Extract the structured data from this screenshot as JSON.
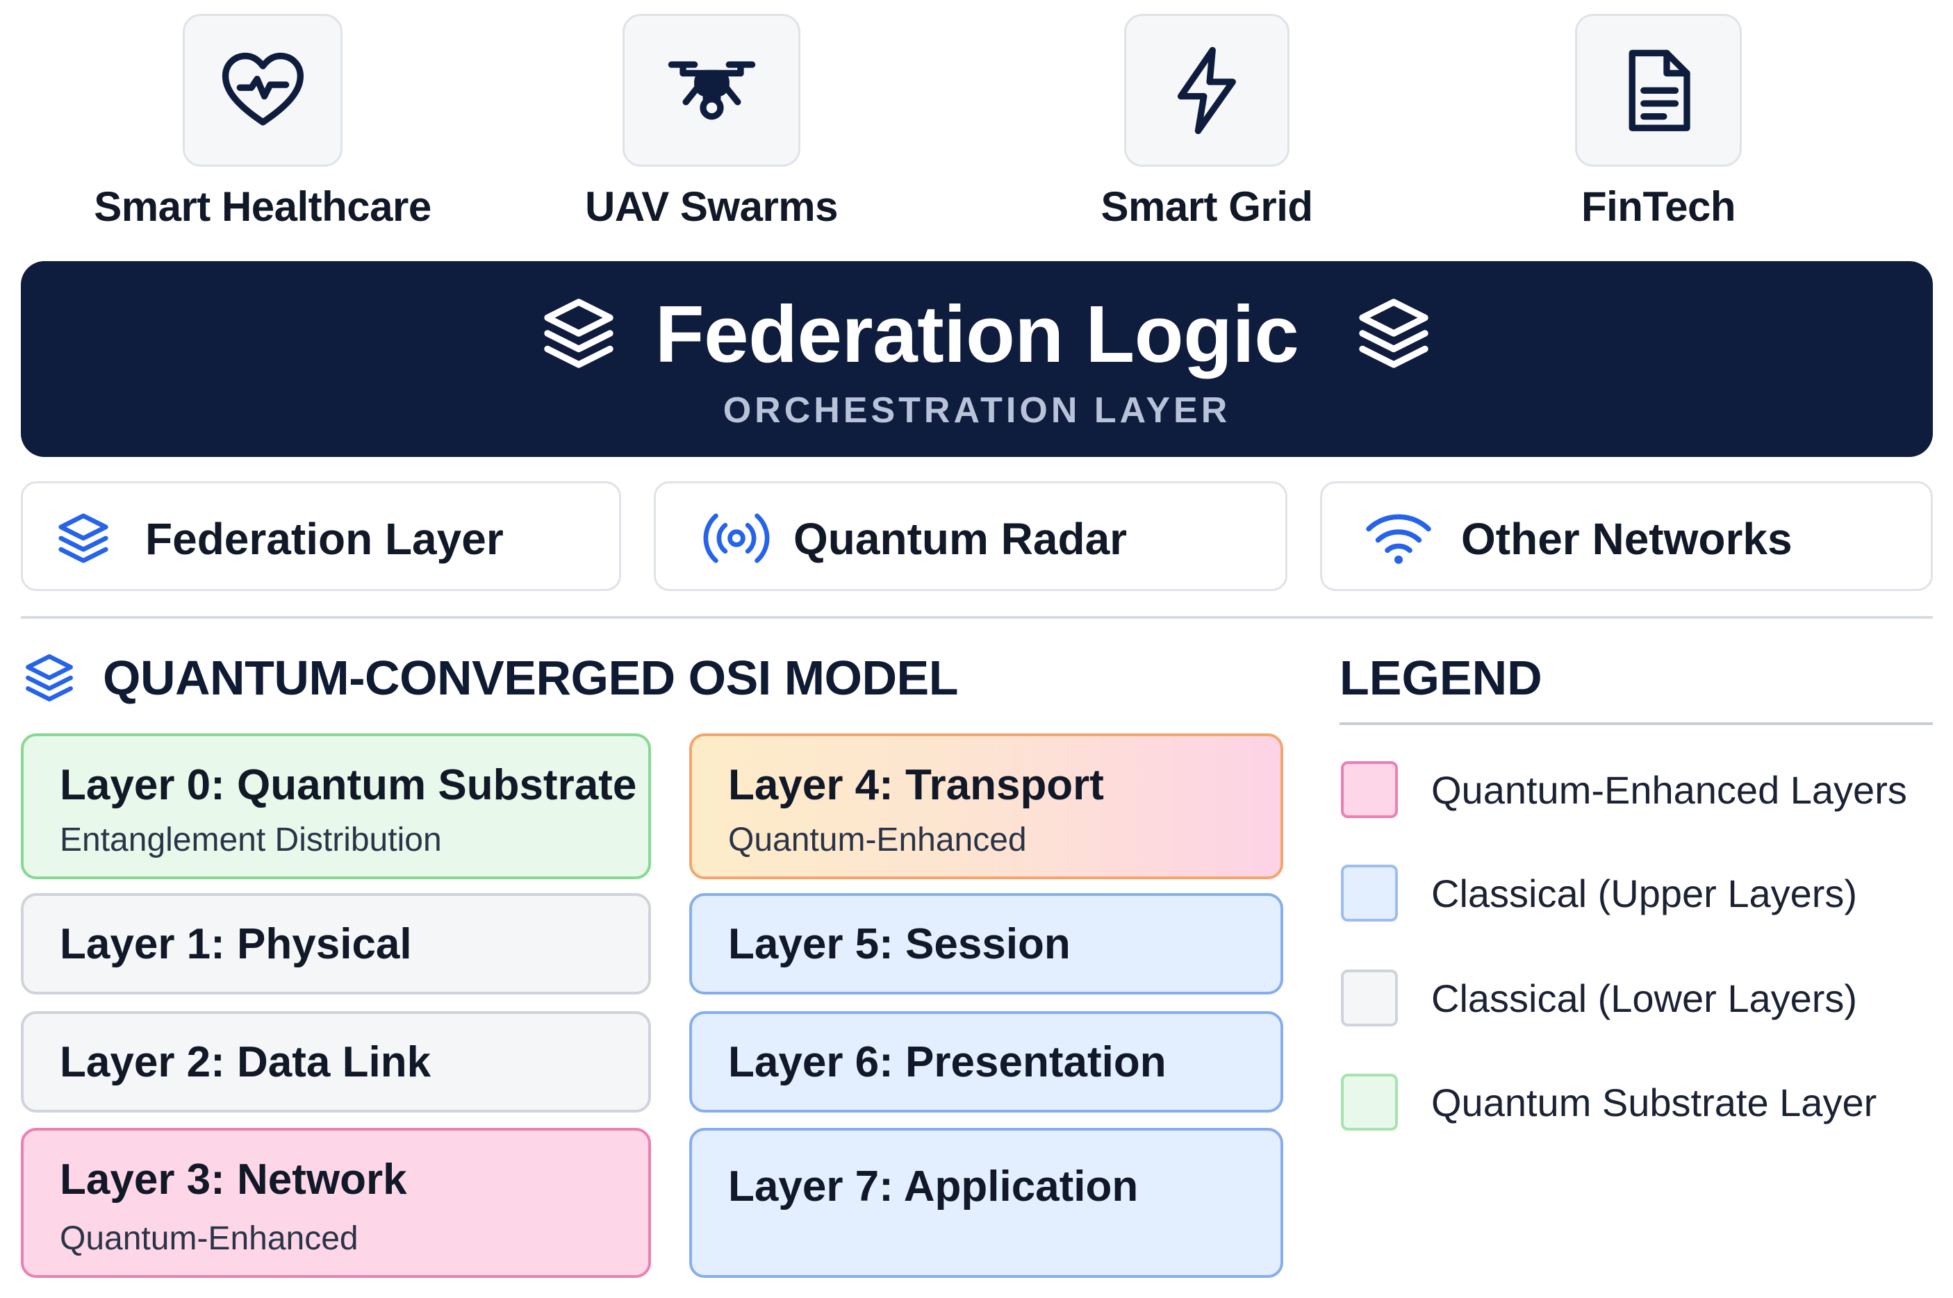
{
  "applications": [
    {
      "label": "Smart Healthcare",
      "icon": "heart-pulse-icon"
    },
    {
      "label": "UAV Swarms",
      "icon": "drone-icon"
    },
    {
      "label": "Smart Grid",
      "icon": "lightning-bolt-icon"
    },
    {
      "label": "FinTech",
      "icon": "document-icon"
    }
  ],
  "banner": {
    "title": "Federation Logic",
    "subtitle": "ORCHESTRATION LAYER",
    "icon": "layers-stack-icon"
  },
  "networks": [
    {
      "label": "Federation Layer",
      "icon": "layers-stack-icon"
    },
    {
      "label": "Quantum Radar",
      "icon": "radar-broadcast-icon"
    },
    {
      "label": "Other Networks",
      "icon": "wifi-icon"
    }
  ],
  "osi": {
    "title": "QUANTUM-CONVERGED OSI MODEL",
    "layers": [
      {
        "name": "Layer 0: Quantum Substrate",
        "sub": "Entanglement Distribution",
        "category": "quantum-substrate"
      },
      {
        "name": "Layer 1: Physical",
        "sub": "",
        "category": "classical-lower"
      },
      {
        "name": "Layer 2: Data Link",
        "sub": "",
        "category": "classical-lower"
      },
      {
        "name": "Layer 3: Network",
        "sub": "Quantum-Enhanced",
        "category": "quantum-enhanced"
      },
      {
        "name": "Layer 4: Transport",
        "sub": "Quantum-Enhanced",
        "category": "quantum-enhanced-gradient"
      },
      {
        "name": "Layer 5: Session",
        "sub": "",
        "category": "classical-upper"
      },
      {
        "name": "Layer 6: Presentation",
        "sub": "",
        "category": "classical-upper"
      },
      {
        "name": "Layer 7: Application",
        "sub": "",
        "category": "classical-upper"
      }
    ]
  },
  "legend": {
    "title": "LEGEND",
    "items": [
      {
        "label": "Quantum-Enhanced Layers",
        "color": "#fdd6e7"
      },
      {
        "label": "Classical (Upper Layers)",
        "color": "#e3eefe"
      },
      {
        "label": "Classical (Lower Layers)",
        "color": "#f5f6f8"
      },
      {
        "label": "Quantum Substrate Layer",
        "color": "#e8f8ea"
      }
    ]
  },
  "colors": {
    "navy": "#0e1c3d",
    "accent_blue": "#2563eb",
    "quantum_enhanced": "#fdd6e7",
    "classical_upper": "#e3eefe",
    "classical_lower": "#f5f6f8",
    "quantum_substrate": "#e8f8ea"
  }
}
